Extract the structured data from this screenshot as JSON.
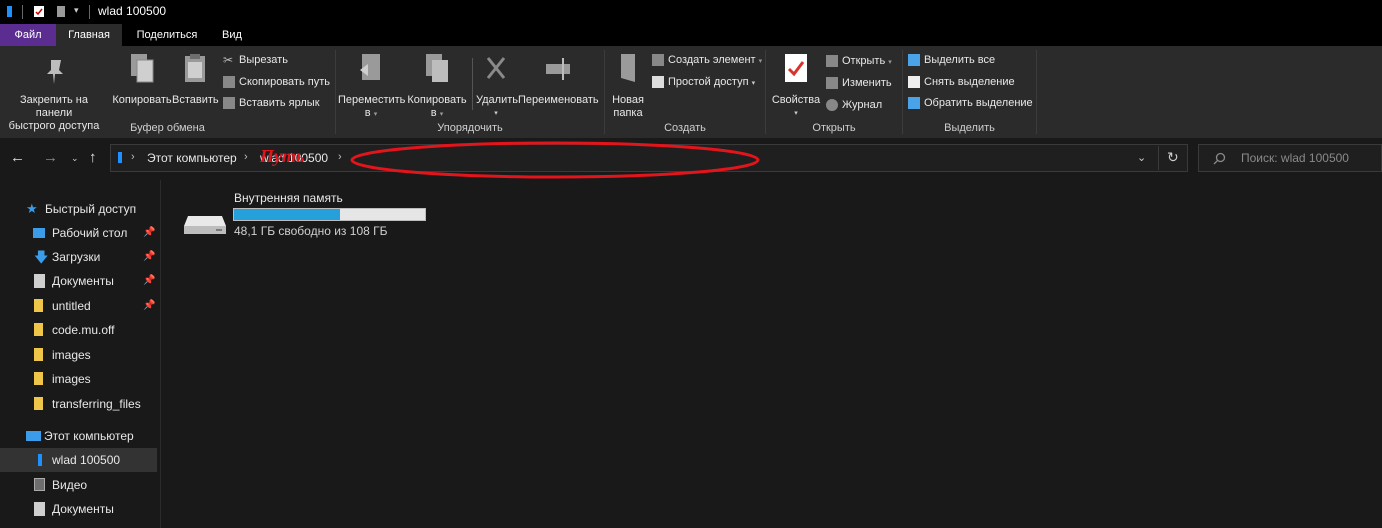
{
  "window": {
    "title": "wlad 100500"
  },
  "tabs": [
    {
      "label": "Файл"
    },
    {
      "label": "Главная"
    },
    {
      "label": "Поделиться"
    },
    {
      "label": "Вид"
    }
  ],
  "ribbon": {
    "clipboard": {
      "pin_line1": "Закрепить на панели",
      "pin_line2": "быстрого доступа",
      "copy": "Копировать",
      "paste": "Вставить",
      "cut": "Вырезать",
      "copy_path": "Скопировать путь",
      "paste_shortcut": "Вставить ярлык",
      "group": "Буфер обмена"
    },
    "organize": {
      "move_line1": "Переместить",
      "move_line2": "в",
      "copyto_line1": "Копировать",
      "copyto_line2": "в",
      "delete": "Удалить",
      "rename": "Переименовать",
      "group": "Упорядочить"
    },
    "new": {
      "folder_line1": "Новая",
      "folder_line2": "папка",
      "new_item": "Создать элемент",
      "easy_access": "Простой доступ",
      "group": "Создать"
    },
    "open": {
      "properties": "Свойства",
      "open": "Открыть",
      "edit": "Изменить",
      "history": "Журнал",
      "group": "Открыть"
    },
    "select": {
      "select_all": "Выделить все",
      "select_none": "Снять выделение",
      "invert": "Обратить выделение",
      "group": "Выделить"
    }
  },
  "address": {
    "crumbs": [
      "Этот компьютер",
      "wlad 100500"
    ],
    "annotation": "Путь",
    "search_placeholder": "Поиск: wlad 100500"
  },
  "sidebar": {
    "quick_access": "Быстрый доступ",
    "items": [
      {
        "label": "Рабочий стол",
        "pinned": true
      },
      {
        "label": "Загрузки",
        "pinned": true
      },
      {
        "label": "Документы",
        "pinned": true
      },
      {
        "label": "untitled",
        "pinned": true
      },
      {
        "label": "code.mu.off",
        "pinned": false
      },
      {
        "label": "images",
        "pinned": false
      },
      {
        "label": "images",
        "pinned": false
      },
      {
        "label": "transferring_files",
        "pinned": false
      }
    ],
    "this_pc": "Этот компьютер",
    "pc_items": [
      {
        "label": "wlad 100500"
      },
      {
        "label": "Видео"
      },
      {
        "label": "Документы"
      }
    ]
  },
  "content": {
    "drive": {
      "name": "Внутренняя память",
      "free_text": "48,1 ГБ свободно из 108 ГБ",
      "used_fraction": 0.555
    }
  },
  "colors": {
    "file_tab": "#5c2d91",
    "progress_fill": "#26a0da",
    "annotation": "#e2141c"
  }
}
